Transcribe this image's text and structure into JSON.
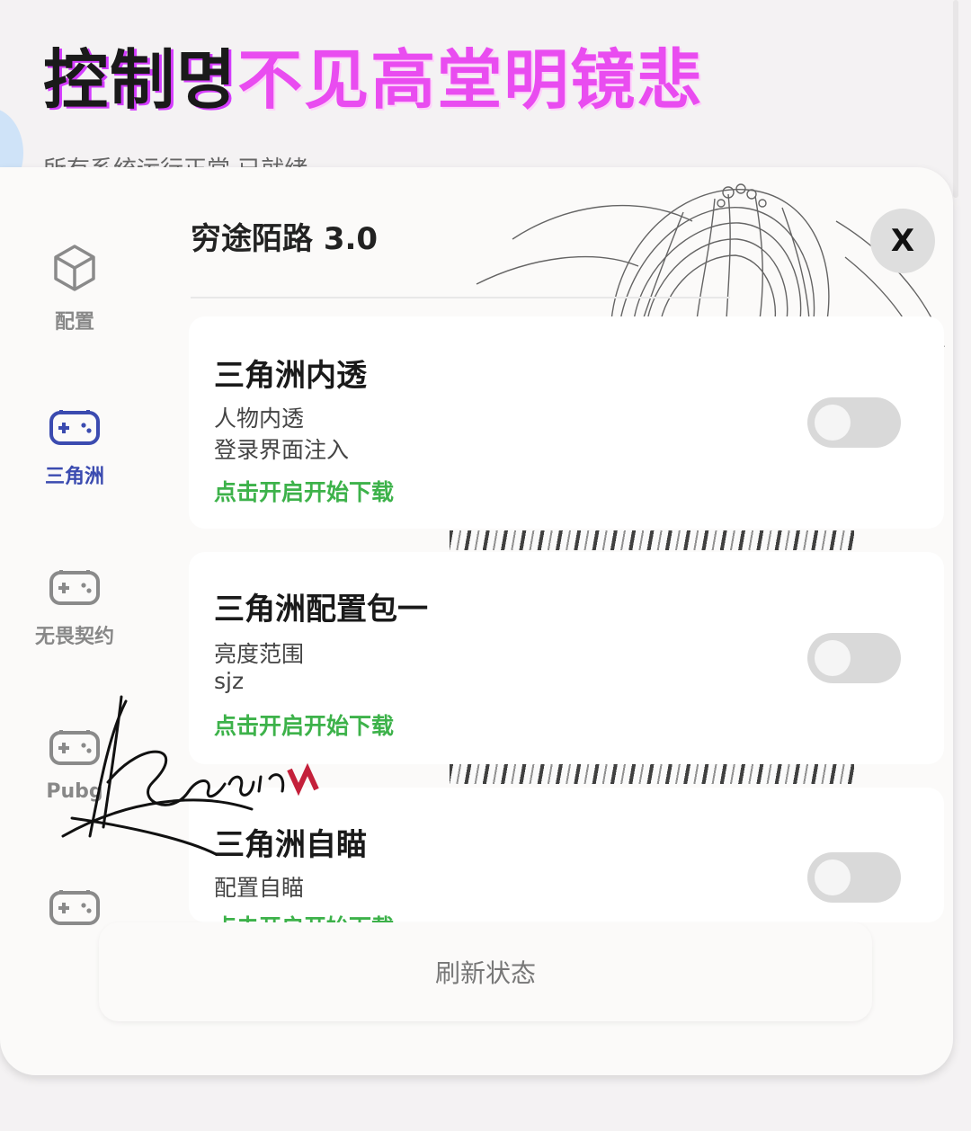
{
  "banner": {
    "title_part1": "控制명",
    "title_part2": "不见高堂明镜悲",
    "subtitle": "所有系统运行正常    已就绪"
  },
  "panel": {
    "title": "穷途陌路 3.0",
    "close_label": "X"
  },
  "sidebar": {
    "items": [
      {
        "label": "配置",
        "icon": "cube-icon",
        "active": false
      },
      {
        "label": "三角洲",
        "icon": "gamepad-icon",
        "active": true
      },
      {
        "label": "无畏契约",
        "icon": "gamepad-icon",
        "active": false
      },
      {
        "label": "Pubg",
        "icon": "gamepad-icon",
        "active": false
      },
      {
        "label": "",
        "icon": "gamepad-icon",
        "active": false
      }
    ]
  },
  "cards": [
    {
      "title": "三角洲内透",
      "lines": [
        "人物内透",
        "登录界面注入"
      ],
      "action": "点击开启开始下载",
      "enabled": false
    },
    {
      "title": "三角洲配置包一",
      "lines": [
        "亮度范围",
        "sjz"
      ],
      "action": "点击开启开始下载",
      "enabled": false
    },
    {
      "title": "三角洲自瞄",
      "lines": [
        "配置自瞄"
      ],
      "action": "点击开启开始下载",
      "enabled": false
    }
  ],
  "refresh_label": "刷新状态",
  "colors": {
    "accent": "#3b4bb0",
    "action_green": "#3db24a",
    "title_magenta": "#e94cf0",
    "toggle_off": "#d9d9d9"
  }
}
